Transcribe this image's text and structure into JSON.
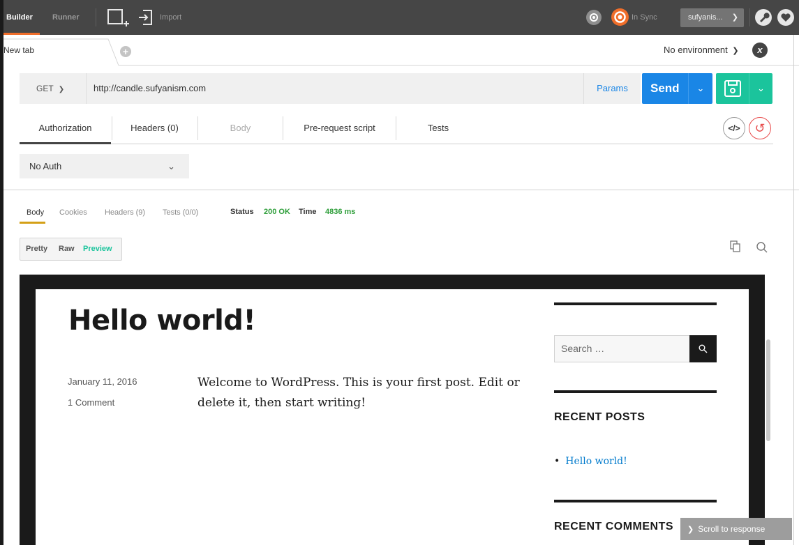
{
  "topbar": {
    "builder_label": "Builder",
    "runner_label": "Runner",
    "import_label": "Import",
    "sync_label": "In Sync",
    "user_label": "sufyanis...",
    "accent": "#f06e2a"
  },
  "tabs": {
    "active_label": "New tab",
    "add_icon": "plus-circle-icon"
  },
  "environment": {
    "label": "No environment"
  },
  "request": {
    "method": "GET",
    "url": "http://candle.sufyanism.com",
    "params_label": "Params",
    "send_label": "Send",
    "send_color": "#1a86e6",
    "save_color": "#1bc49c"
  },
  "request_tabs": [
    {
      "label": "Authorization"
    },
    {
      "label": "Headers (0)"
    },
    {
      "label": "Body"
    },
    {
      "label": "Pre-request script"
    },
    {
      "label": "Tests"
    }
  ],
  "auth": {
    "selected": "No Auth"
  },
  "response": {
    "tabs": [
      {
        "label": "Body"
      },
      {
        "label": "Cookies"
      },
      {
        "label": "Headers (9)"
      },
      {
        "label": "Tests (0/0)"
      }
    ],
    "status_label": "Status",
    "status_value": "200 OK",
    "time_label": "Time",
    "time_value": "4836 ms",
    "formats": [
      {
        "label": "Pretty"
      },
      {
        "label": "Raw"
      },
      {
        "label": "Preview"
      }
    ]
  },
  "preview": {
    "title": "Hello world!",
    "date": "January 11, 2016",
    "comments": "1 Comment",
    "body": "Welcome to WordPress. This is your first post. Edit or delete it, then start writing!",
    "search_placeholder": "Search …",
    "recent_posts_heading": "RECENT POSTS",
    "recent_post_item": "Hello world!",
    "recent_comments_heading": "RECENT COMMENTS"
  },
  "scroll_to_response_label": "Scroll to response"
}
